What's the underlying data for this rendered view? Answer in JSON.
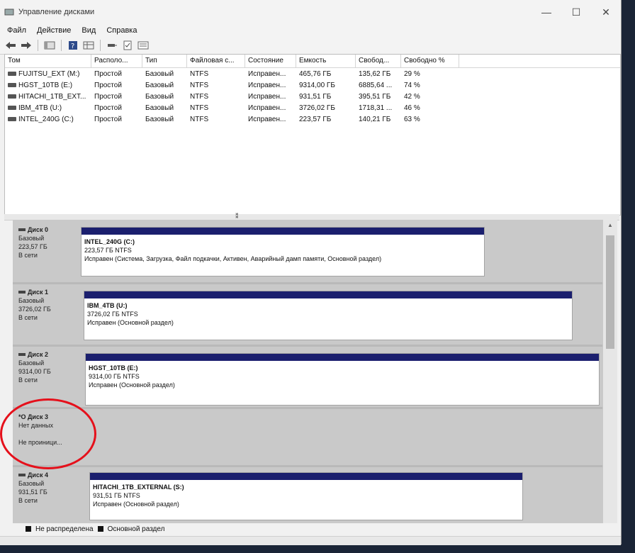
{
  "window": {
    "title": "Управление дисками"
  },
  "menu": [
    "Файл",
    "Действие",
    "Вид",
    "Справка"
  ],
  "volume_list": {
    "headers": [
      "Том",
      "Располо...",
      "Тип",
      "Файловая с...",
      "Состояние",
      "Емкость",
      "Свобод...",
      "Свободно %"
    ],
    "rows": [
      [
        "FUJITSU_EXT (M:)",
        "Простой",
        "Базовый",
        "NTFS",
        "Исправен...",
        "465,76 ГБ",
        "135,62 ГБ",
        "29 %"
      ],
      [
        "HGST_10TB (E:)",
        "Простой",
        "Базовый",
        "NTFS",
        "Исправен...",
        "9314,00 ГБ",
        "6885,64 ...",
        "74 %"
      ],
      [
        "HITACHI_1TB_EXT...",
        "Простой",
        "Базовый",
        "NTFS",
        "Исправен...",
        "931,51 ГБ",
        "395,51 ГБ",
        "42 %"
      ],
      [
        "IBM_4TB (U:)",
        "Простой",
        "Базовый",
        "NTFS",
        "Исправен...",
        "3726,02 ГБ",
        "1718,31 ...",
        "46 %"
      ],
      [
        "INTEL_240G (C:)",
        "Простой",
        "Базовый",
        "NTFS",
        "Исправен...",
        "223,57 ГБ",
        "140,21 ГБ",
        "63 %"
      ]
    ]
  },
  "disks": [
    {
      "name": "Диск 0",
      "type": "Базовый",
      "size": "223,57 ГБ",
      "status": "В сети",
      "partition": {
        "label": "INTEL_240G (C:)",
        "size": "223,57 ГБ NTFS",
        "status": "Исправен (Система, Загрузка, Файл подкачки, Активен, Аварийный дамп памяти, Основной раздел)"
      }
    },
    {
      "name": "Диск 1",
      "type": "Базовый",
      "size": "3726,02 ГБ",
      "status": "В сети",
      "partition": {
        "label": "IBM_4TB (U:)",
        "size": "3726,02 ГБ NTFS",
        "status": "Исправен (Основной раздел)"
      }
    },
    {
      "name": "Диск 2",
      "type": "Базовый",
      "size": "9314,00 ГБ",
      "status": "В сети",
      "partition": {
        "label": "HGST_10TB (E:)",
        "size": "9314,00 ГБ NTFS",
        "status": "Исправен (Основной раздел)"
      }
    },
    {
      "name": "*О Диск 3",
      "type": "Нет данных",
      "size": "",
      "status": "Не проиници..."
    },
    {
      "name": "Диск 4",
      "type": "Базовый",
      "size": "931,51 ГБ",
      "status": "В сети",
      "partition": {
        "label": "HITACHI_1TB_EXTERNAL (S:)",
        "size": "931,51 ГБ NTFS",
        "status": "Исправен (Основной раздел)"
      }
    }
  ],
  "legend": [
    "Не распределена",
    "Основной раздел"
  ],
  "colors": {
    "partition_bar": "#1b1f6e",
    "highlight_circle": "#e5101b"
  }
}
